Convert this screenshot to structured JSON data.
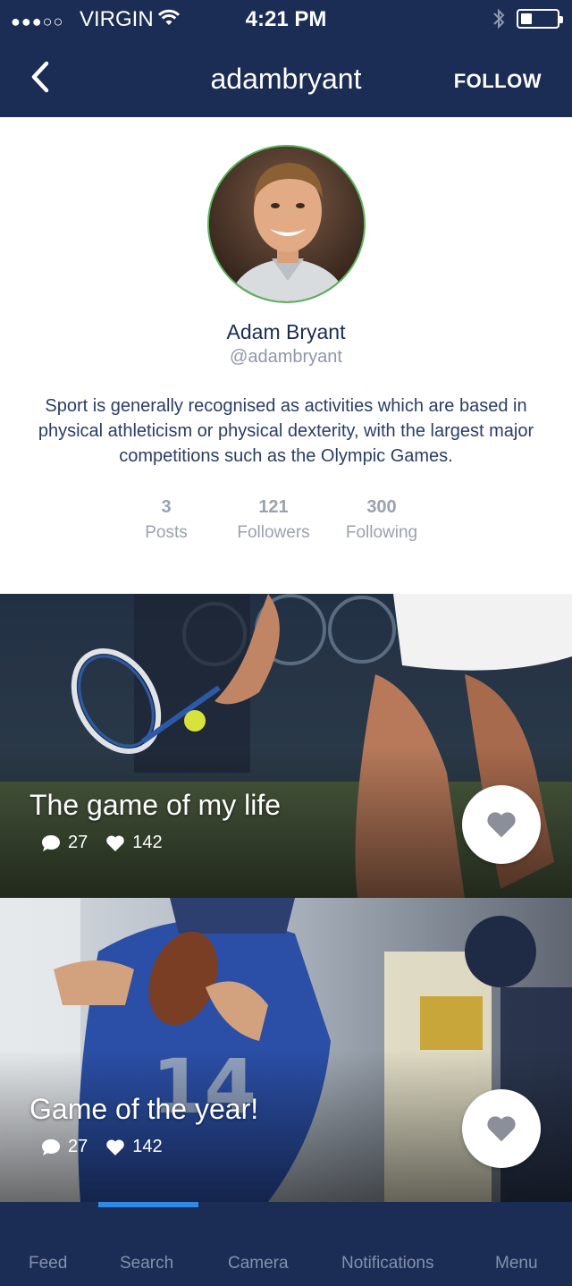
{
  "status_bar": {
    "carrier": "VIRGIN",
    "time": "4:21 PM"
  },
  "nav": {
    "title": "adambryant",
    "follow_label": "FOLLOW"
  },
  "profile": {
    "name": "Adam Bryant",
    "handle": "@adambryant",
    "bio": "Sport is generally recognised as activities which are based in physical athleticism or physical dexterity, with the largest major competitions such as the Olympic Games.",
    "stats": [
      {
        "value": "3",
        "label": "Posts"
      },
      {
        "value": "121",
        "label": "Followers"
      },
      {
        "value": "300",
        "label": "Following"
      }
    ]
  },
  "posts": [
    {
      "title": "The game of my life",
      "comments": "27",
      "likes": "142"
    },
    {
      "title": "Game of the year!",
      "comments": "27",
      "likes": "142"
    }
  ],
  "tabs": [
    {
      "label": "Feed"
    },
    {
      "label": "Search"
    },
    {
      "label": "Camera"
    },
    {
      "label": "Notifications"
    },
    {
      "label": "Menu"
    }
  ],
  "colors": {
    "nav_bg": "#1b2d54",
    "accent": "#2e8ae6",
    "text_primary": "#1b2d54",
    "text_muted": "#9aa1b0"
  }
}
